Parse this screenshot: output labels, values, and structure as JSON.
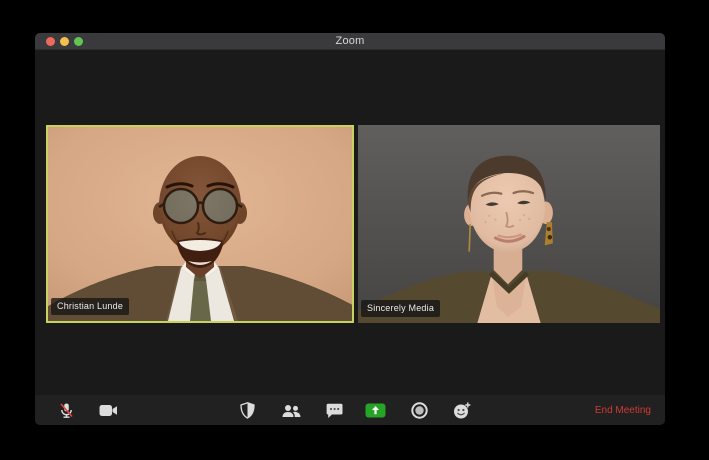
{
  "window": {
    "title": "Zoom",
    "traffic_lights": {
      "close": "#ec6a5e",
      "minimize": "#f5bf4f",
      "zoom": "#61c454"
    }
  },
  "participants": [
    {
      "name": "Christian Lunde",
      "active_speaker": true
    },
    {
      "name": "Sincerely Media",
      "active_speaker": false
    }
  ],
  "toolbar": {
    "icons": [
      "microphone-muted-icon",
      "video-camera-icon",
      "security-shield-icon",
      "participants-icon",
      "chat-bubble-icon",
      "share-screen-icon",
      "record-icon",
      "reactions-icon"
    ],
    "end_meeting_label": "End Meeting"
  },
  "colors": {
    "active_speaker_border": "#c8d35b",
    "end_meeting_red": "#cf3a33",
    "share_screen_green": "#27a427",
    "titlebar_bg": "#3a3a3c",
    "window_bg": "#1a1a1b",
    "toolbar_bg": "#212122",
    "mute_slash_red": "#e0453c"
  }
}
